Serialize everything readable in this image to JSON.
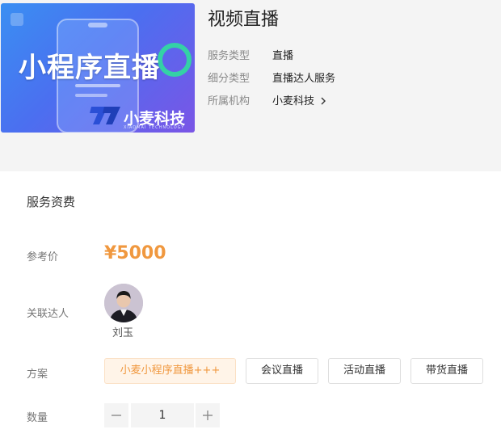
{
  "product": {
    "banner_title": "小程序直播",
    "brand_name": "小麦科技",
    "brand_sub": "XIAOMAI TECHNOLOGY",
    "title": "视频直播",
    "meta": [
      {
        "label": "服务类型",
        "value": "直播"
      },
      {
        "label": "细分类型",
        "value": "直播达人服务"
      },
      {
        "label": "所属机构",
        "value": "小麦科技"
      }
    ]
  },
  "pricing": {
    "section_title": "服务资费",
    "price_label": "参考价",
    "price": "¥5000",
    "talent_label": "关联达人",
    "talent_name": "刘玉",
    "plan_label": "方案",
    "plans": [
      {
        "label": "小麦小程序直播+++",
        "selected": true
      },
      {
        "label": "会议直播",
        "selected": false
      },
      {
        "label": "活动直播",
        "selected": false
      },
      {
        "label": "带货直播",
        "selected": false
      }
    ],
    "quantity_label": "数量",
    "quantity": "1"
  },
  "colors": {
    "accent": "#f0983f",
    "selected_bg": "#fff4e8",
    "banner_start": "#3a8ff2",
    "banner_end": "#7a55e6"
  },
  "icons": {
    "institution_link": "chevron-right-icon",
    "decrement": "minus-icon",
    "increment": "plus-icon"
  }
}
